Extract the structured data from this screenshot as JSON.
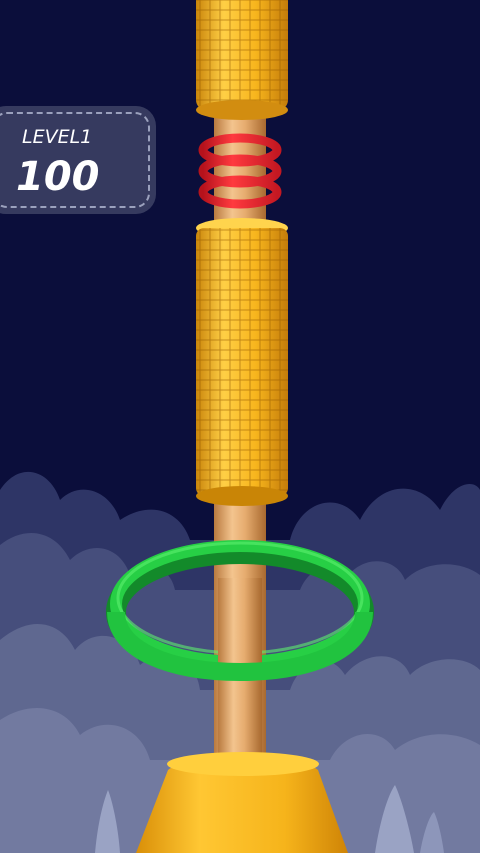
{
  "hud": {
    "level_label": "LEVEL1",
    "score": "100"
  },
  "colors": {
    "sky": "#0b0e3b",
    "cloud_back": "#3a4170",
    "cloud_mid": "#4f5782",
    "cloud_front": "#6e769b",
    "pole": "#e7b27a",
    "gold_block": "#f5b51e",
    "red_ring": "#e8252f",
    "green_ring": "#1fbf3a",
    "base": "#f2b219"
  },
  "scene": {
    "stacked_blocks": 2,
    "red_rings": 3,
    "green_ring": 1
  }
}
